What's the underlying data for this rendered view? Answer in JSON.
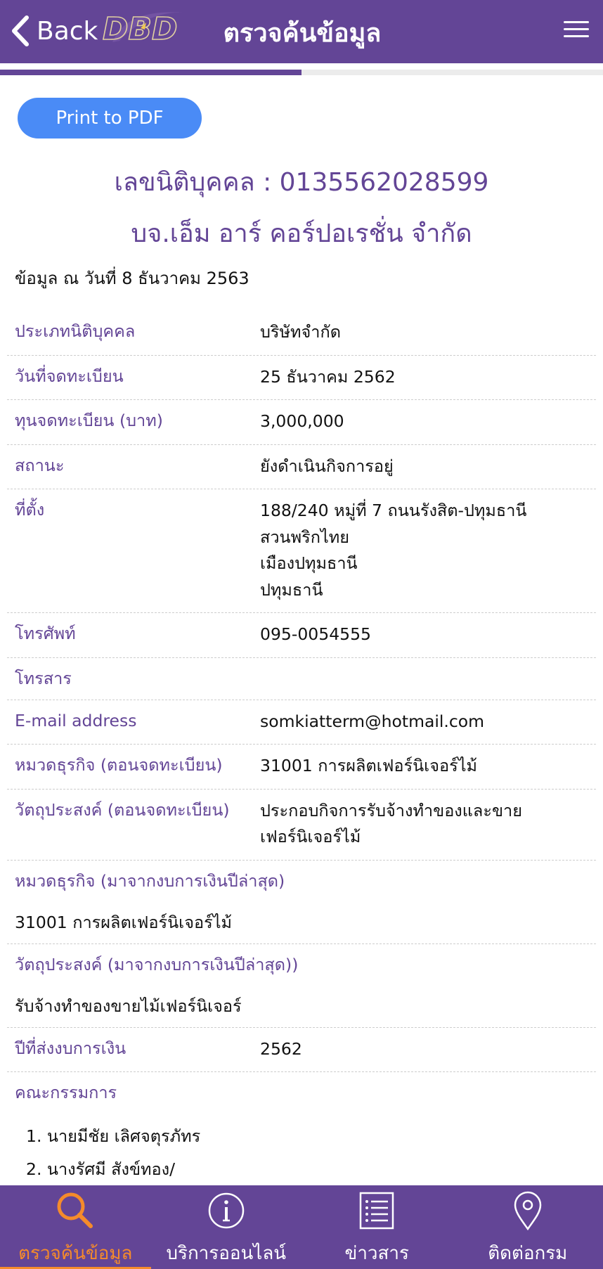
{
  "header": {
    "back_label": "Back",
    "logo_text": "DBD",
    "title": "ตรวจค้นข้อมูล"
  },
  "progress": {
    "fraction": 0.5
  },
  "print_button": "Print to PDF",
  "registration": {
    "label": "เลขนิติบุคคล : 0135562028599",
    "company_name": "บจ.เอ็ม อาร์ คอร์ปอเรชั่น จำกัด",
    "as_of": "ข้อมูล ณ วันที่ 8 ธันวาคม 2563"
  },
  "fields": {
    "type": {
      "label": "ประเภทนิติบุคคล",
      "value": "บริษัทจำกัด"
    },
    "reg_date": {
      "label": "วันที่จดทะเบียน",
      "value": "25 ธันวาคม 2562"
    },
    "capital": {
      "label": "ทุนจดทะเบียน (บาท)",
      "value": "3,000,000"
    },
    "status": {
      "label": "สถานะ",
      "value": "ยังดำเนินกิจการอยู่"
    },
    "address": {
      "label": "ที่ตั้ง",
      "lines": [
        "188/240 หมู่ที่ 7 ถนนรังสิต-ปทุมธานี",
        "สวนพริกไทย",
        "เมืองปทุมธานี",
        "ปทุมธานี"
      ]
    },
    "phone": {
      "label": "โทรศัพท์",
      "value": "095-0054555"
    },
    "fax": {
      "label": "โทรสาร",
      "value": ""
    },
    "email": {
      "label": "E-mail address",
      "value": "somkiatterm@hotmail.com"
    },
    "category_reg": {
      "label": "หมวดธุรกิจ (ตอนจดทะเบียน)",
      "value": "31001 การผลิตเฟอร์นิเจอร์ไม้"
    },
    "objective_reg": {
      "label": "วัตถุประสงค์ (ตอนจดทะเบียน)",
      "lines": [
        "ประกอบกิจการรับจ้างทำของและขาย",
        "เฟอร์นิเจอร์ไม้"
      ]
    },
    "category_fin": {
      "label": "หมวดธุรกิจ (มาจากงบการเงินปีล่าสุด)",
      "value": "31001 การผลิตเฟอร์นิเจอร์ไม้"
    },
    "objective_fin": {
      "label": "วัตถุประสงค์ (มาจากงบการเงินปีล่าสุด))",
      "value": "รับจ้างทำของขายไม้เฟอร์นิเจอร์"
    },
    "fin_year": {
      "label": "ปีที่ส่งงบการเงิน",
      "value": "2562"
    },
    "directors": {
      "label": "คณะกรรมการ",
      "items": [
        "1. นายมีชัย เลิศจตุรภัทร",
        "2. นางรัศมี สังข์ทอง/"
      ]
    }
  },
  "bottom_nav": {
    "items": [
      {
        "label": "ตรวจค้นข้อมูล",
        "icon": "search-icon",
        "active": true
      },
      {
        "label": "บริการออนไลน์",
        "icon": "info-icon",
        "active": false
      },
      {
        "label": "ข่าวสาร",
        "icon": "news-list-icon",
        "active": false
      },
      {
        "label": "ติดต่อกรม",
        "icon": "location-pin-icon",
        "active": false
      }
    ]
  },
  "colors": {
    "primary": "#634596",
    "button": "#4a8bf6",
    "active_nav": "#f58b2b"
  }
}
